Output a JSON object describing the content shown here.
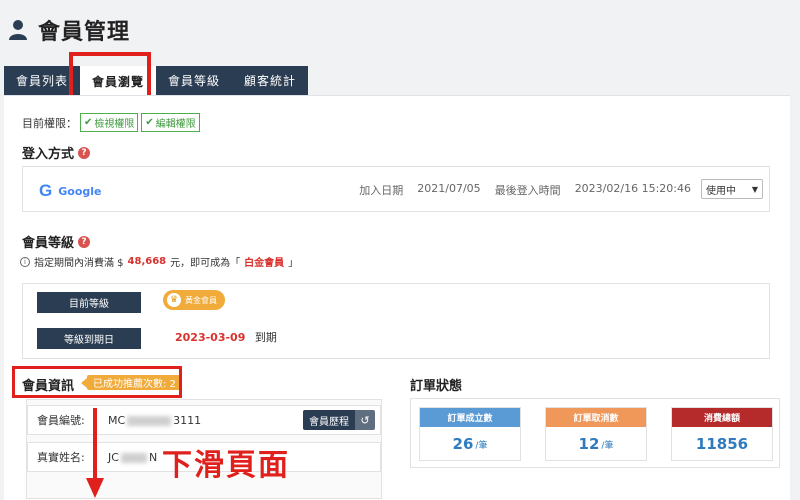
{
  "header": {
    "title": "會員管理",
    "icon": "user-icon"
  },
  "tabs": [
    {
      "label": "會員列表",
      "active": false
    },
    {
      "label": "會員瀏覽",
      "active": true
    },
    {
      "label": "會員等級",
      "active": false
    },
    {
      "label": "顧客統計",
      "active": false
    }
  ],
  "permissions": {
    "label": "目前權限：",
    "badges": [
      "檢視權限",
      "編輯權限"
    ]
  },
  "login": {
    "section_title": "登入方式",
    "provider": "Google",
    "provider_mark": "G",
    "join_label": "加入日期",
    "join_date": "2021/07/05",
    "last_login_label": "最後登入時間",
    "last_login": "2023/02/16 15:20:46",
    "status": "使用中"
  },
  "level": {
    "section_title": "會員等級",
    "note_prefix": "指定期間內消費滿 $",
    "amount": "48,668",
    "note_mid": "元，即可成為「",
    "target_level": "白金會員",
    "note_suffix": "」",
    "current_label": "目前等級",
    "current_badge": "黃金會員",
    "expiry_label": "等級到期日",
    "expiry_date": "2023-03-09",
    "expiry_suffix": "到期"
  },
  "member_info": {
    "section_title": "會員資訊",
    "tag": "已成功推薦次數: 2",
    "id_label": "會員編號:",
    "id_prefix": "MC",
    "id_suffix": "3111",
    "history_button": "會員歷程",
    "name_label": "真實姓名:",
    "name_prefix": "JC",
    "name_suffix": "N"
  },
  "orders": {
    "section_title": "訂單狀態",
    "cards": [
      {
        "label": "訂單成立數",
        "value": "26",
        "unit": "/筆",
        "color": "#5b9bd5"
      },
      {
        "label": "訂單取消數",
        "value": "12",
        "unit": "/筆",
        "color": "#f0975a"
      },
      {
        "label": "消費總額",
        "value": "11856",
        "unit": "",
        "color": "#b52a2a"
      }
    ]
  },
  "annotation": {
    "scroll_hint": "下滑頁面",
    "highlight_color": "#e0201d"
  }
}
